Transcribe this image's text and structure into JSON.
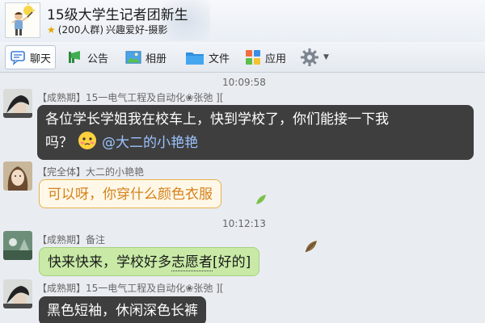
{
  "header": {
    "group_name": "15级大学生记者团新生",
    "member_count": "(200人群)",
    "interests": "兴趣爱好-摄影",
    "avatar_icon": "group-avatar-icon",
    "star_icon": "star-icon"
  },
  "toolbar": {
    "tabs": [
      {
        "label": "聊天",
        "icon": "chat-icon"
      },
      {
        "label": "公告",
        "icon": "megaphone-icon"
      },
      {
        "label": "相册",
        "icon": "photo-icon"
      },
      {
        "label": "文件",
        "icon": "folder-icon"
      },
      {
        "label": "应用",
        "icon": "apps-icon"
      },
      {
        "label": "",
        "icon": "gear-icon"
      }
    ]
  },
  "messages": [
    {
      "timestamp": "10:09:58",
      "sender": "【成熟期】15一电气工程及自动化❀张弛 ][",
      "text_line1": "各位学长学姐我在校车上，快到学校了，你们能接一下我",
      "text_line2": "吗？",
      "mention": "@大二的小艳艳",
      "style": "dark"
    },
    {
      "sender": "【完全体】大二的小艳艳",
      "text": "可以呀，你穿什么颜色衣服",
      "style": "cream"
    },
    {
      "timestamp": "10:12:13",
      "sender": "【成熟期】备注",
      "text_before": "快来快来，学校好多",
      "text_dotted": "志愿者",
      "text_after": "[好的]",
      "style": "green"
    },
    {
      "sender": "【成熟期】15一电气工程及自动化❀张弛 ][",
      "text": "黑色短袖，休闲深色长裤",
      "style": "dark"
    }
  ],
  "colors": {
    "dark_bubble": "#3e3e3e",
    "cream_bubble_text": "#d4811a",
    "green_bubble": "#c8eaa6",
    "mention": "#9bc3ff"
  }
}
